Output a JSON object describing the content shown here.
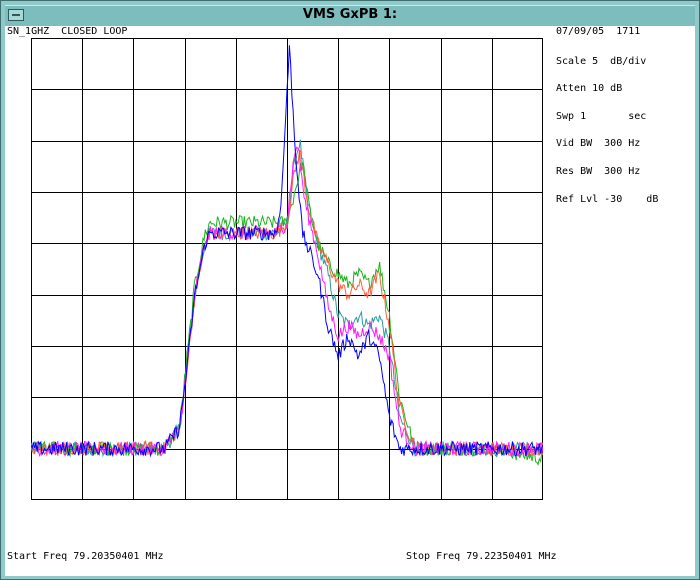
{
  "window": {
    "title": "VMS GxPB 1:"
  },
  "header": {
    "left": "SN_1GHZ  CLOSED LOOP",
    "date_time": "07/09/05  1711"
  },
  "settings": [
    "Scale 5  dB/div",
    "Atten 10 dB",
    "Swp 1       sec",
    "Vid BW  300 Hz",
    "Res BW  300 Hz",
    "Ref Lvl -30    dB"
  ],
  "footer": {
    "start": "Start Freq 79.20350401 MHz",
    "stop": "Stop Freq 79.22350401 MHz"
  },
  "colors": {
    "grid": "#000000",
    "traces": [
      "#2a9d9d",
      "#1ab31a",
      "#ff5f40",
      "#ff1aff",
      "#0000ff"
    ]
  },
  "chart_data": {
    "type": "line",
    "grid": true,
    "divisions": {
      "x": 10,
      "y": 9
    },
    "x_range_mhz": [
      79.20350401,
      79.22350401
    ],
    "ref_level_db": -30,
    "scale_db_per_div": 5,
    "series": [
      {
        "color": "cyan",
        "x": [
          0,
          1.0,
          2.6,
          2.9,
          3.05,
          3.2,
          3.4,
          3.5,
          4.0,
          4.8,
          5.0,
          5.15,
          5.25,
          5.4,
          5.6,
          5.8,
          6.0,
          6.2,
          6.4,
          6.6,
          6.8,
          7.0,
          7.2,
          7.5,
          8.0,
          9.0,
          10
        ],
        "y": [
          -70,
          -70,
          -70,
          -68,
          -62,
          -55,
          -50,
          -49,
          -49,
          -49,
          -48,
          -42,
          -40,
          -46,
          -50,
          -53,
          -57,
          -58,
          -57,
          -58,
          -57,
          -60,
          -67,
          -70,
          -70,
          -70,
          -70
        ]
      },
      {
        "color": "green",
        "x": [
          0,
          1.0,
          2.6,
          2.9,
          3.05,
          3.2,
          3.4,
          3.5,
          4.0,
          4.8,
          5.0,
          5.15,
          5.3,
          5.45,
          5.6,
          5.8,
          6.0,
          6.2,
          6.4,
          6.6,
          6.8,
          7.0,
          7.2,
          7.5,
          8.0,
          9.0,
          10
        ],
        "y": [
          -70,
          -70,
          -70,
          -68,
          -61,
          -54,
          -49,
          -48,
          -48,
          -48,
          -48,
          -45,
          -42,
          -47,
          -50,
          -52,
          -53,
          -54,
          -53,
          -54,
          -52,
          -57,
          -65,
          -70,
          -70,
          -70,
          -71
        ]
      },
      {
        "color": "orange",
        "x": [
          0,
          1.0,
          2.6,
          2.9,
          3.05,
          3.2,
          3.4,
          3.5,
          4.0,
          4.8,
          5.0,
          5.15,
          5.25,
          5.4,
          5.6,
          5.8,
          6.0,
          6.2,
          6.4,
          6.6,
          6.8,
          7.0,
          7.2,
          7.5,
          8.0,
          9.0,
          10
        ],
        "y": [
          -70,
          -70,
          -70,
          -68,
          -62,
          -55,
          -50,
          -49,
          -49,
          -49,
          -48,
          -43,
          -41,
          -46,
          -50,
          -52,
          -54,
          -55,
          -54,
          -55,
          -53,
          -58,
          -66,
          -70,
          -70,
          -70,
          -70
        ]
      },
      {
        "color": "magenta",
        "x": [
          0,
          1.0,
          2.6,
          2.9,
          3.05,
          3.2,
          3.4,
          3.5,
          4.0,
          4.8,
          5.0,
          5.1,
          5.2,
          5.35,
          5.6,
          5.8,
          6.0,
          6.2,
          6.4,
          6.6,
          6.8,
          7.0,
          7.2,
          7.5,
          8.0,
          9.0,
          10
        ],
        "y": [
          -70,
          -70,
          -70,
          -68,
          -62,
          -55,
          -50,
          -49,
          -49,
          -49,
          -48,
          -43,
          -40,
          -46,
          -51,
          -56,
          -59,
          -58,
          -59,
          -58,
          -59,
          -61,
          -68,
          -70,
          -70,
          -70,
          -70
        ]
      },
      {
        "color": "blue",
        "x": [
          0,
          1.0,
          2.6,
          2.9,
          3.05,
          3.2,
          3.4,
          3.5,
          4.0,
          4.8,
          4.9,
          5.0,
          5.05,
          5.15,
          5.3,
          5.6,
          5.8,
          6.0,
          6.2,
          6.4,
          6.6,
          6.8,
          7.0,
          7.2,
          7.5,
          8.0,
          9.0,
          10
        ],
        "y": [
          -70,
          -70,
          -70,
          -68,
          -62,
          -55,
          -50,
          -49,
          -49,
          -49,
          -45,
          -35,
          -31,
          -40,
          -49,
          -53,
          -58,
          -61,
          -59,
          -61,
          -59,
          -61,
          -67,
          -70,
          -70,
          -70,
          -70,
          -70
        ]
      }
    ]
  }
}
